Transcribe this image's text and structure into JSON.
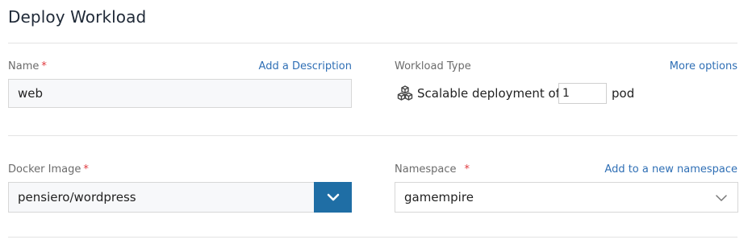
{
  "page": {
    "title": "Deploy Workload"
  },
  "name_field": {
    "label": "Name",
    "required_mark": "*",
    "add_description_link": "Add a Description",
    "value": "web"
  },
  "workload_type": {
    "label": "Workload Type",
    "more_options_link": "More options",
    "icon": "cubes-icon",
    "prefix_text": "Scalable deployment of",
    "count": "1",
    "suffix_text": "pod"
  },
  "docker_image": {
    "label": "Docker Image",
    "required_mark": "*",
    "value": "pensiero/wordpress",
    "dropdown_icon": "chevron-down-icon"
  },
  "namespace": {
    "label": "Namespace",
    "required_mark": "*",
    "add_namespace_link": "Add to a new namespace",
    "value": "gamempire",
    "dropdown_icon": "chevron-down-icon"
  },
  "colors": {
    "accent": "#1f6ea5",
    "link": "#2f6fb5",
    "required": "#e0393e"
  }
}
